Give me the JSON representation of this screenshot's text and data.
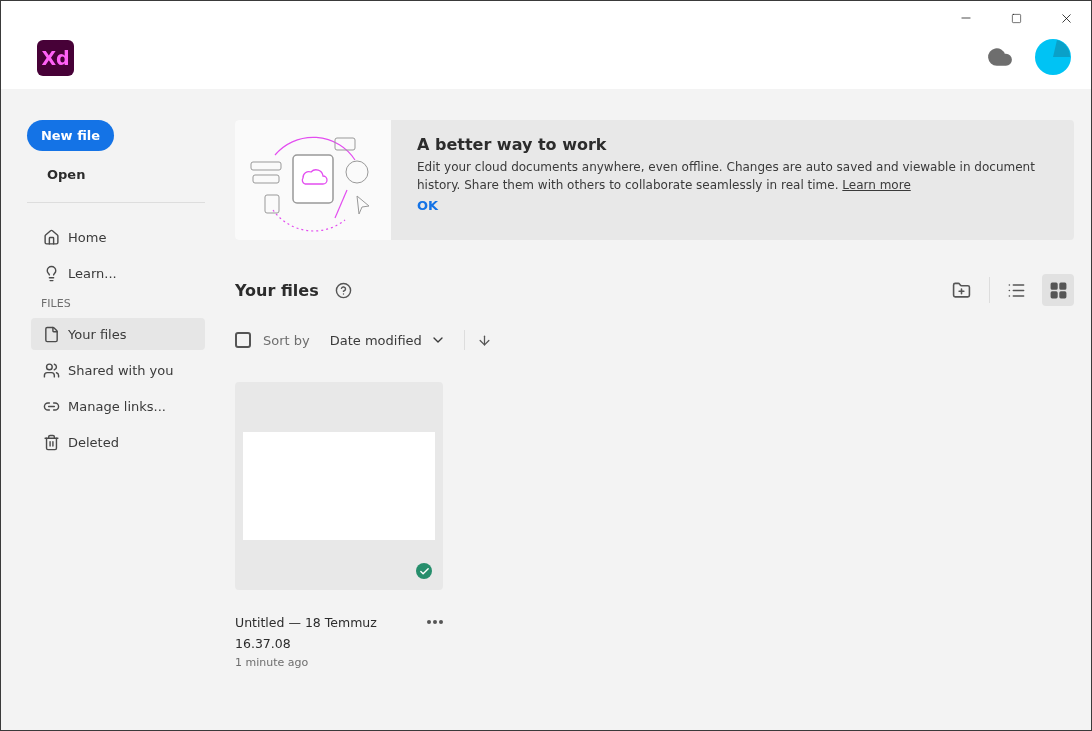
{
  "header": {
    "logo": "Xd"
  },
  "sidebar": {
    "new_file": "New file",
    "open": "Open",
    "items": [
      {
        "label": "Home",
        "selected": false
      },
      {
        "label": "Learn...",
        "selected": false
      }
    ],
    "section": "FILES",
    "files_items": [
      {
        "label": "Your files",
        "selected": true
      },
      {
        "label": "Shared with you",
        "selected": false
      },
      {
        "label": "Manage links...",
        "selected": false
      },
      {
        "label": "Deleted",
        "selected": false
      }
    ]
  },
  "banner": {
    "title": "A better way to work",
    "text": "Edit your cloud documents anywhere, even offline. Changes are auto saved and viewable in document history. Share them with others to collaborate seamlessly in real time.",
    "link": "Learn more",
    "ok": "OK"
  },
  "files": {
    "title": "Your files",
    "views": [
      {
        "kind": "list",
        "selected": false
      },
      {
        "kind": "grid",
        "selected": true
      }
    ],
    "select_all": {
      "checked": false
    },
    "sort_label": "Sort by",
    "sort_value": "Date modified",
    "items": [
      {
        "name": "Untitled — 18 Temmuz 16.37.08",
        "time": "1 minute ago",
        "synced": true
      }
    ]
  }
}
